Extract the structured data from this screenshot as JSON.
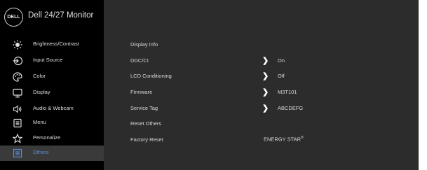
{
  "header": {
    "logo": "DELL",
    "title": "Dell 24/27 Monitor"
  },
  "sidebar": {
    "items": [
      {
        "label": "Brightness/Contrast",
        "icon": "brightness-icon",
        "active": false
      },
      {
        "label": "Input Source",
        "icon": "input-source-icon",
        "active": false
      },
      {
        "label": "Color",
        "icon": "color-palette-icon",
        "active": false
      },
      {
        "label": "Display",
        "icon": "display-icon",
        "active": false
      },
      {
        "label": "Audio & Webcam",
        "icon": "speaker-icon",
        "active": false
      },
      {
        "label": "Menu",
        "icon": "menu-icon",
        "active": false
      },
      {
        "label": "Personalize",
        "icon": "star-icon",
        "active": false
      },
      {
        "label": "Others",
        "icon": "others-icon",
        "active": true
      }
    ]
  },
  "content": {
    "rows": [
      {
        "label": "Display Info",
        "value": ""
      },
      {
        "label": "DDC/CI",
        "value": "On"
      },
      {
        "label": "LCD Conditioning",
        "value": "Off"
      },
      {
        "label": "Firmware",
        "value": "M3T101"
      },
      {
        "label": "Service Tag",
        "value": "ABCDEFG"
      },
      {
        "label": "Reset Others",
        "value": ""
      },
      {
        "label": "Factory Reset",
        "value": ""
      }
    ],
    "energy_star": "ENERGY STAR",
    "energy_star_mark": "®"
  },
  "colors": {
    "sidebar_bg": "#000000",
    "panel_bg": "#2c2c2c",
    "active_text": "#5b8fd6"
  }
}
